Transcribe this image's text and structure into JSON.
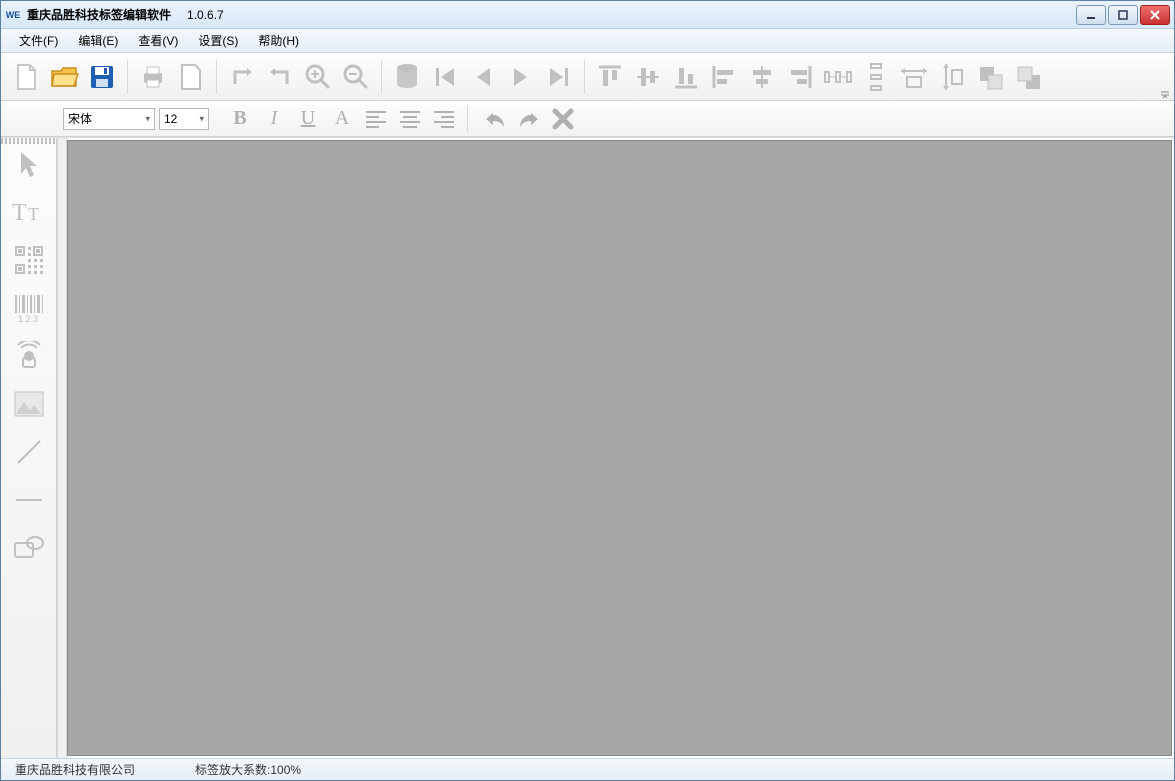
{
  "title": "重庆品胜科技标签编辑软件",
  "version": "1.0.6.7",
  "menu": {
    "file": "文件(F)",
    "edit": "编辑(E)",
    "view": "查看(V)",
    "settings": "设置(S)",
    "help": "帮助(H)"
  },
  "format": {
    "font_name": "宋体",
    "font_size": "12"
  },
  "status": {
    "company": "重庆品胜科技有限公司",
    "zoom_label": "标签放大系数:100%"
  }
}
